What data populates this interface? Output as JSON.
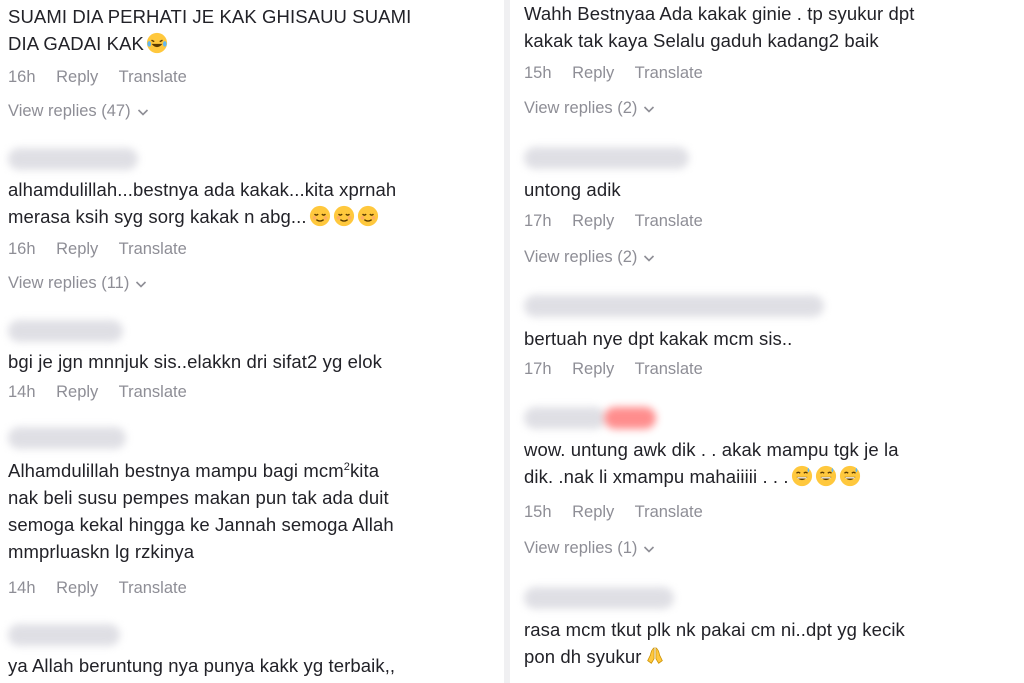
{
  "left": {
    "c1": {
      "line1": "SUAMI DIA PERHATI JE KAK GHISAUU SUAMI",
      "line2": "DIA GADAI KAK",
      "time": "16h",
      "reply": "Reply",
      "translate": "Translate",
      "view_replies": "View replies (47)"
    },
    "c2": {
      "line1": "alhamdulillah...bestnya ada kakak...kita xprnah",
      "line2": "merasa ksih syg sorg kakak n abg...",
      "time": "16h",
      "reply": "Reply",
      "translate": "Translate",
      "view_replies": "View replies (11)"
    },
    "c3": {
      "line1": "bgi je jgn mnnjuk sis..elakkn dri sifat2 yg elok",
      "time": "14h",
      "reply": "Reply",
      "translate": "Translate"
    },
    "c4": {
      "line1a": "Alhamdulillah bestnya mampu bagi mcm",
      "line1sup": "2",
      "line1b": "kita",
      "line2": "nak beli susu pempes makan pun tak ada duit",
      "line3": "semoga kekal hingga ke Jannah semoga Allah",
      "line4": "mmprluaskn lg rzkinya",
      "time": "14h",
      "reply": "Reply",
      "translate": "Translate"
    },
    "c5": {
      "line1": "ya Allah beruntung nya punya kakk yg terbaik,,"
    }
  },
  "right": {
    "c1": {
      "line1": "Wahh Bestnyaa Ada kakak ginie . tp syukur dpt",
      "line2": "kakak tak kaya Selalu gaduh kadang2 baik",
      "time": "15h",
      "reply": "Reply",
      "translate": "Translate",
      "view_replies": "View replies (2)"
    },
    "c2": {
      "line1": "untong adik",
      "time": "17h",
      "reply": "Reply",
      "translate": "Translate",
      "view_replies": "View replies (2)"
    },
    "c3": {
      "line1": "bertuah nye dpt kakak mcm sis..",
      "time": "17h",
      "reply": "Reply",
      "translate": "Translate"
    },
    "c4": {
      "line1": "wow. untung awk dik . . akak mampu tgk je la",
      "line2": "dik. .nak li xmampu mahaiiiii . . .",
      "time": "15h",
      "reply": "Reply",
      "translate": "Translate",
      "view_replies": "View replies (1)"
    },
    "c5": {
      "line1": "rasa mcm tkut plk nk pakai cm ni..dpt yg kecik",
      "line2": "pon dh syukur"
    }
  },
  "colors": {
    "text": "#222228",
    "meta": "#8e8e96",
    "blur_name": "#dcdce2",
    "emoji_yellow": "#ffc83d"
  }
}
